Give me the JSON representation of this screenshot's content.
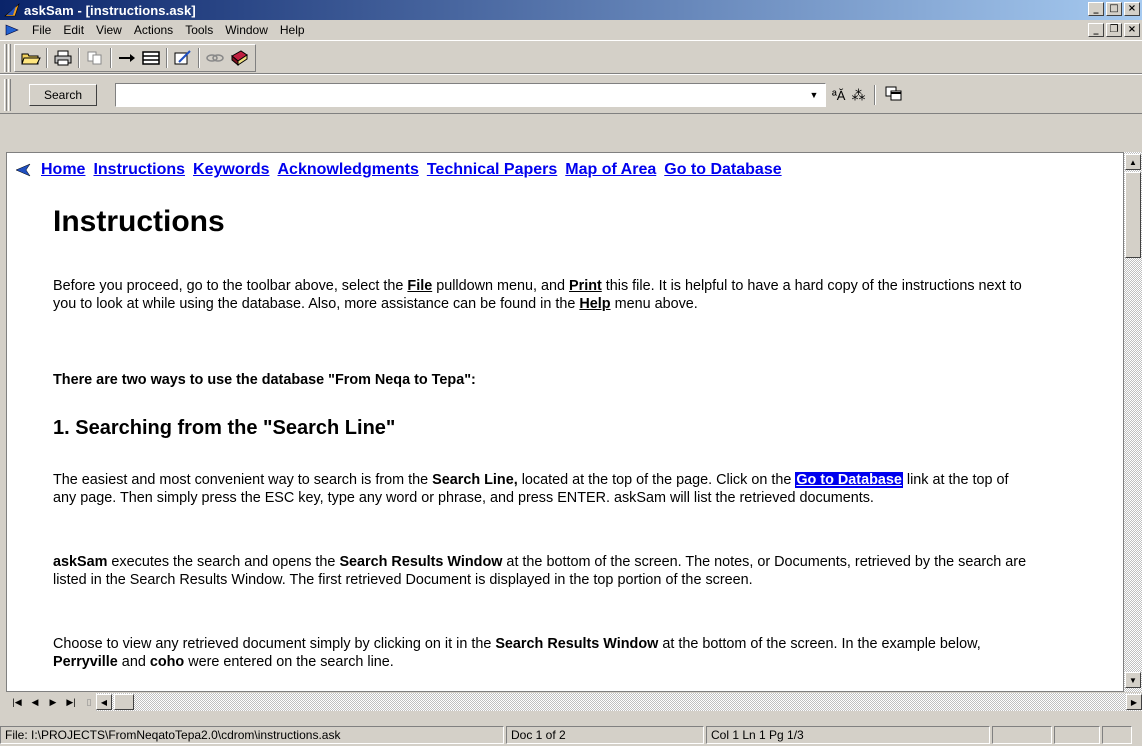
{
  "window": {
    "title": "askSam - [instructions.ask]",
    "min": "_",
    "max": "□",
    "close": "×",
    "mdi_min": "_",
    "mdi_restore": "❐",
    "mdi_close": "×"
  },
  "menu": [
    {
      "label": "File"
    },
    {
      "label": "Edit"
    },
    {
      "label": "View"
    },
    {
      "label": "Actions"
    },
    {
      "label": "Tools"
    },
    {
      "label": "Window"
    },
    {
      "label": "Help"
    }
  ],
  "search": {
    "button_label": "Search",
    "value": "",
    "placeholder": ""
  },
  "nav_links": [
    "Home",
    "Instructions",
    "Keywords",
    "Acknowledgments",
    "Technical Papers",
    "Map of Area",
    "Go to Database"
  ],
  "doc": {
    "heading": "Instructions",
    "p1": {
      "a": "Before you proceed, go to the toolbar above, select the ",
      "b": "File",
      "c": " pulldown menu, and ",
      "d": "Print",
      "e": " this file.  It is helpful to have a hard copy of the instructions next to you to look at while using the database.  Also, more assistance can be found in the ",
      "f": "Help",
      "g": " menu above."
    },
    "two_ways": "There are two ways to use the database \"From Neqa to Tepa\":",
    "section1": "1.  Searching from the \"Search Line\"",
    "p2": {
      "a": "The easiest and most convenient way to search is from the ",
      "b": "Search Line,",
      "c": " located at the top of the page. Click on the ",
      "link": "Go to Database",
      "d": " link at the top of any page.  Then simply press the ESC key, type any word or phrase, and press ENTER. askSam will list the retrieved documents."
    },
    "p3": {
      "a": "askSam",
      "b": " executes the search and opens the ",
      "c": "Search Results Window",
      "d": " at the bottom of the screen. The notes, or Documents, retrieved by the search are listed in the Search Results Window. The first retrieved Document is displayed in the top portion of the screen."
    },
    "p4": {
      "a": "Choose to view any retrieved document simply by clicking on it in the ",
      "b": "Search Results Window",
      "c": " at the bottom of the screen.   In the example below, ",
      "d": "Perryville",
      "e": " and ",
      "f": "coho",
      "g": " were entered on the search line."
    }
  },
  "status": {
    "file": "File: I:\\PROJECTS\\FromNeqatoTepa2.0\\cdrom\\instructions.ask",
    "doc": "Doc 1 of 2",
    "pos": "Col 1  Ln 1  Pg 1/3"
  },
  "icons": {
    "app": "asksam-app-icon",
    "open": "folder-open-icon",
    "print": "printer-icon",
    "copy": "copy-icon",
    "arrow": "arrow-right-icon",
    "form": "form-icon",
    "edit": "edit-icon",
    "link": "link-icon",
    "book": "book-icon",
    "az": "az-sort-icon",
    "asterisk": "asterisk-icon",
    "windows": "windows-icon"
  }
}
